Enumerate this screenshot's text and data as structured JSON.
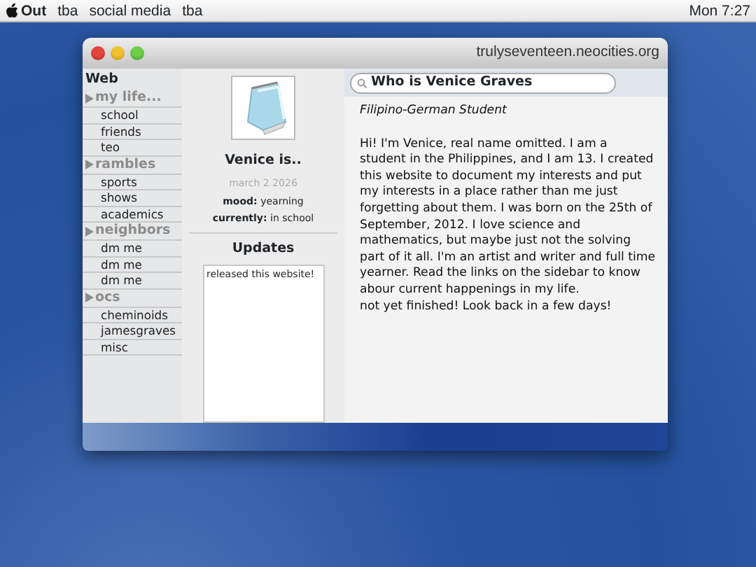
{
  "menu_bar": {
    "app": "Out",
    "items": [
      "tba",
      "social media",
      "tba"
    ],
    "clock": "Mon 7:27"
  },
  "window": {
    "title": "trulyseventeen.neocities.org"
  },
  "sidebar": {
    "heading": "Web",
    "groups": [
      {
        "label": "my life...",
        "items": [
          "school",
          "friends",
          "teo"
        ]
      },
      {
        "label": "rambles",
        "items": [
          "sports",
          "shows",
          "academics"
        ]
      },
      {
        "label": "neighbors",
        "items": [
          "dm me",
          "dm me",
          "dm me"
        ]
      },
      {
        "label": "ocs",
        "items": [
          "cheminoids",
          "jamesgraves",
          "misc"
        ]
      }
    ]
  },
  "profile": {
    "name": "Venice is..",
    "date": "march 2 2026",
    "fields": [
      {
        "label": "mood:",
        "value": "yearning"
      },
      {
        "label": "currently:",
        "value": "in school"
      }
    ],
    "updates_title": "Updates",
    "updates": [
      "released this website!"
    ]
  },
  "main": {
    "search_value": "Who is Venice Graves",
    "subtitle": "Filipino-German Student",
    "paragraphs": [
      "Hi! I'm Venice, real name omitted. I am a student in the Philippines, and I am 13. I created this website to document my interests and put my interests in a place rather than me just forgetting about them. I was born on the 25th of September, 2012. I love science and mathematics, but maybe just not the solving part of it all. I'm an artist and writer and full time yearner. Read the links on the sidebar to know abour current happenings in my life.",
      "not yet finished! Look back in a few days!"
    ]
  }
}
